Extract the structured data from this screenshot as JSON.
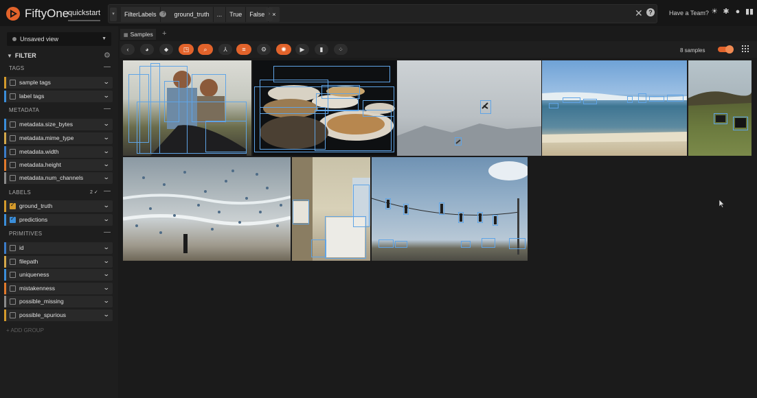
{
  "header": {
    "app_title": "FiftyOne",
    "dataset": "quickstart",
    "view_stage": {
      "name": "FilterLabels",
      "field": "ground_truth",
      "more": "...",
      "opt1": "True",
      "opt2": "False",
      "close": "×"
    },
    "team_link": "Have a Team?",
    "clear": "✕",
    "help": "?"
  },
  "sidebar": {
    "view_select": "Unsaved view",
    "filter_label": "FILTER",
    "sections": {
      "tags": "TAGS",
      "metadata": "METADATA",
      "labels": "LABELS",
      "primitives": "PRIMITIVES"
    },
    "labels_count": "2 ✓",
    "tags": [
      {
        "label": "sample tags",
        "color": "#d49a2c"
      },
      {
        "label": "label tags",
        "color": "#3b8ed9"
      }
    ],
    "metadata": [
      {
        "label": "metadata.size_bytes",
        "color": "#3b8ed9"
      },
      {
        "label": "metadata.mime_type",
        "color": "#d4a84a"
      },
      {
        "label": "metadata.width",
        "color": "#3b7cc9"
      },
      {
        "label": "metadata.height",
        "color": "#e27a2c"
      },
      {
        "label": "metadata.num_channels",
        "color": "#8a8a8a"
      }
    ],
    "labels": [
      {
        "label": "ground_truth",
        "color": "#d49a2c",
        "checked": true
      },
      {
        "label": "predictions",
        "color": "#3b8ed9",
        "checked": true
      }
    ],
    "primitives": [
      {
        "label": "id",
        "color": "#3b7cc9"
      },
      {
        "label": "filepath",
        "color": "#d4a84a"
      },
      {
        "label": "uniqueness",
        "color": "#3b8ed9"
      },
      {
        "label": "mistakenness",
        "color": "#e27a2c"
      },
      {
        "label": "possible_missing",
        "color": "#8a8a8a"
      },
      {
        "label": "possible_spurious",
        "color": "#d49a2c"
      }
    ],
    "add_group": "+ ADD GROUP"
  },
  "main": {
    "tab": "Samples",
    "tab_add": "+",
    "sample_count": "8 samples"
  },
  "colors": {
    "accent": "#e2632b",
    "box": "#5fa4e6"
  }
}
